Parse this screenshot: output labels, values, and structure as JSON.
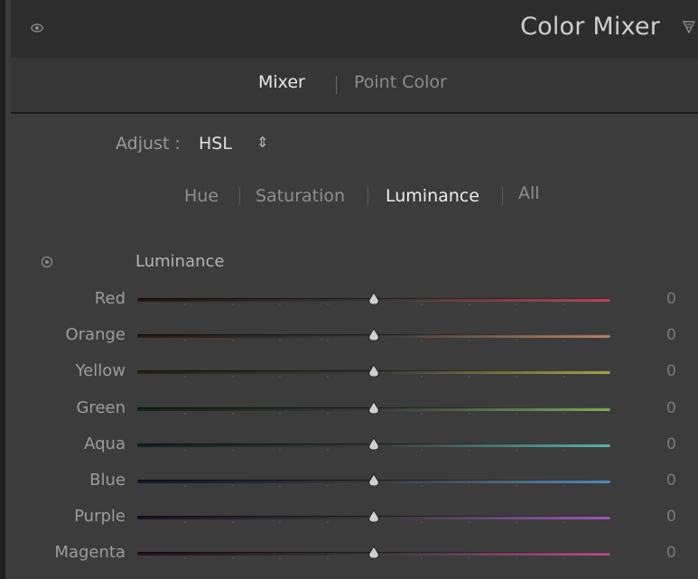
{
  "header": {
    "title": "Color Mixer",
    "eye_icon": "eye-icon",
    "collapse_icon": "collapse-triangle-icon"
  },
  "mode_tabs": {
    "items": [
      "Mixer",
      "Point Color"
    ],
    "active": "Mixer"
  },
  "adjust": {
    "label": "Adjust :",
    "value": "HSL",
    "arrow": "⇕"
  },
  "property_tabs": {
    "items": [
      "Hue",
      "Saturation",
      "Luminance",
      "All"
    ],
    "active": "Luminance"
  },
  "section": {
    "title": "Luminance",
    "target_icon": "targeted-adjustment-icon"
  },
  "sliders": [
    {
      "label": "Red",
      "value": "0",
      "level": 0.5,
      "color_from": "#2a1414",
      "color_to": "#b54a55"
    },
    {
      "label": "Orange",
      "value": "0",
      "level": 0.5,
      "color_from": "#2a1c12",
      "color_to": "#b5866a"
    },
    {
      "label": "Yellow",
      "value": "0",
      "level": 0.5,
      "color_from": "#26240e",
      "color_to": "#a8a24e"
    },
    {
      "label": "Green",
      "value": "0",
      "level": 0.5,
      "color_from": "#132513",
      "color_to": "#7cae62"
    },
    {
      "label": "Aqua",
      "value": "0",
      "level": 0.5,
      "color_from": "#0f2423",
      "color_to": "#5fb3a8"
    },
    {
      "label": "Blue",
      "value": "0",
      "level": 0.5,
      "color_from": "#10192a",
      "color_to": "#5b8ab8"
    },
    {
      "label": "Purple",
      "value": "0",
      "level": 0.5,
      "color_from": "#1e1226",
      "color_to": "#9a5cb4"
    },
    {
      "label": "Magenta",
      "value": "0",
      "level": 0.5,
      "color_from": "#26121f",
      "color_to": "#b04f8a"
    }
  ]
}
